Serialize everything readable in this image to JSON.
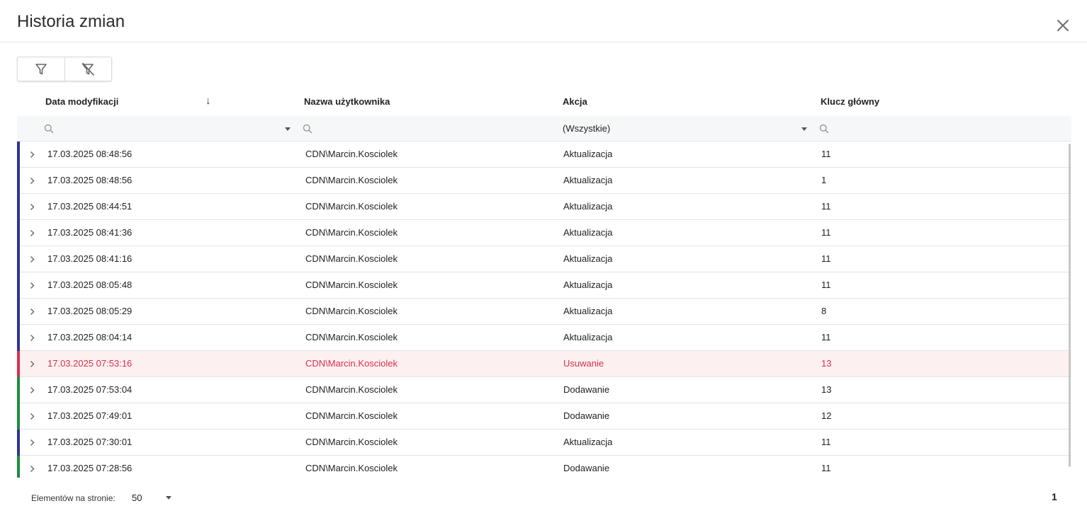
{
  "dialog": {
    "title": "Historia zmian"
  },
  "toolbar": {
    "filter_icon": "filter-icon",
    "clear_filter_icon": "filter-clear-icon"
  },
  "columns": {
    "date": "Data modyfikacji",
    "user": "Nazwa użytkownika",
    "action": "Akcja",
    "key": "Klucz główny"
  },
  "sort": {
    "column": "date",
    "direction": "descending"
  },
  "filters": {
    "date": "",
    "user": "",
    "action": "(Wszystkie)",
    "key": ""
  },
  "colors": {
    "update": "#2f3592",
    "delete": "#d6314c",
    "add": "#1e8c3c"
  },
  "rows": [
    {
      "date": "17.03.2025 08:48:56",
      "user": "CDN\\Marcin.Kosciolek",
      "action": "Aktualizacja",
      "key": "11",
      "type": "update"
    },
    {
      "date": "17.03.2025 08:48:56",
      "user": "CDN\\Marcin.Kosciolek",
      "action": "Aktualizacja",
      "key": "1",
      "type": "update"
    },
    {
      "date": "17.03.2025 08:44:51",
      "user": "CDN\\Marcin.Kosciolek",
      "action": "Aktualizacja",
      "key": "11",
      "type": "update"
    },
    {
      "date": "17.03.2025 08:41:36",
      "user": "CDN\\Marcin.Kosciolek",
      "action": "Aktualizacja",
      "key": "11",
      "type": "update"
    },
    {
      "date": "17.03.2025 08:41:16",
      "user": "CDN\\Marcin.Kosciolek",
      "action": "Aktualizacja",
      "key": "11",
      "type": "update"
    },
    {
      "date": "17.03.2025 08:05:48",
      "user": "CDN\\Marcin.Kosciolek",
      "action": "Aktualizacja",
      "key": "11",
      "type": "update"
    },
    {
      "date": "17.03.2025 08:05:29",
      "user": "CDN\\Marcin.Kosciolek",
      "action": "Aktualizacja",
      "key": "8",
      "type": "update"
    },
    {
      "date": "17.03.2025 08:04:14",
      "user": "CDN\\Marcin.Kosciolek",
      "action": "Aktualizacja",
      "key": "11",
      "type": "update"
    },
    {
      "date": "17.03.2025 07:53:16",
      "user": "CDN\\Marcin.Kosciolek",
      "action": "Usuwanie",
      "key": "13",
      "type": "delete"
    },
    {
      "date": "17.03.2025 07:53:04",
      "user": "CDN\\Marcin.Kosciolek",
      "action": "Dodawanie",
      "key": "13",
      "type": "add"
    },
    {
      "date": "17.03.2025 07:49:01",
      "user": "CDN\\Marcin.Kosciolek",
      "action": "Dodawanie",
      "key": "12",
      "type": "add"
    },
    {
      "date": "17.03.2025 07:30:01",
      "user": "CDN\\Marcin.Kosciolek",
      "action": "Aktualizacja",
      "key": "11",
      "type": "update"
    },
    {
      "date": "17.03.2025 07:28:56",
      "user": "CDN\\Marcin.Kosciolek",
      "action": "Dodawanie",
      "key": "11",
      "type": "add"
    }
  ],
  "pager": {
    "label": "Elementów na stronie:",
    "page_size": "50",
    "current_page": "1"
  }
}
